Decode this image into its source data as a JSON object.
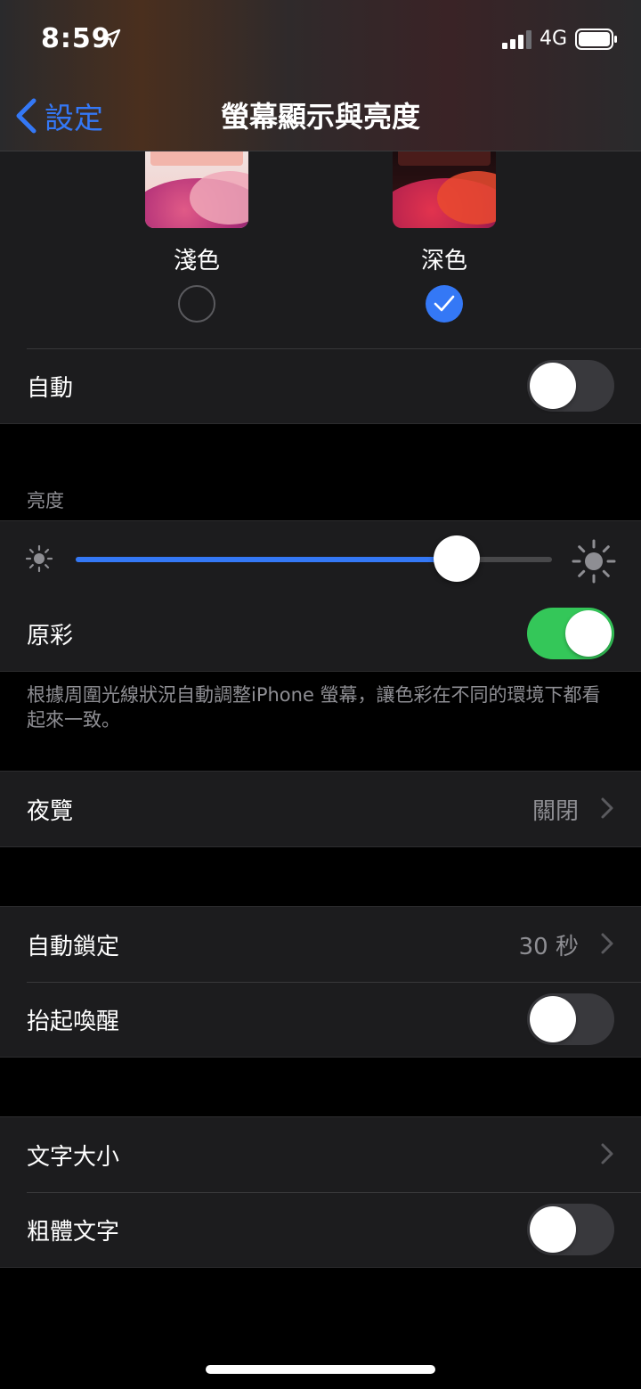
{
  "status": {
    "time": "8:59",
    "network": "4G"
  },
  "nav": {
    "back_label": "設定",
    "title": "螢幕顯示與亮度"
  },
  "appearance": {
    "light_label": "淺色",
    "dark_label": "深色",
    "selected": "dark",
    "auto_label": "自動",
    "auto_on": false
  },
  "brightness": {
    "header": "亮度",
    "level": 0.8,
    "true_tone_label": "原彩",
    "true_tone_on": true,
    "footer": "根據周圍光線狀況自動調整iPhone 螢幕，讓色彩在不同的環境下都看起來一致。"
  },
  "night_shift": {
    "label": "夜覽",
    "value": "關閉"
  },
  "lock": {
    "auto_lock_label": "自動鎖定",
    "auto_lock_value": "30 秒",
    "raise_to_wake_label": "抬起喚醒",
    "raise_to_wake_on": false
  },
  "text": {
    "text_size_label": "文字大小",
    "bold_text_label": "粗體文字",
    "bold_text_on": false
  },
  "colors": {
    "accent": "#3478f6",
    "toggle_on": "#34c759",
    "background": "#000000",
    "cell": "#1c1c1e"
  }
}
